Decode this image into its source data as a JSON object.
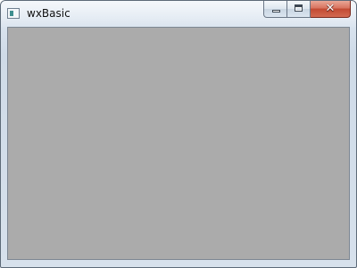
{
  "window": {
    "title": "wxBasic",
    "icon": "app-window-icon"
  },
  "caption_buttons": {
    "minimize_icon": "minimize-icon",
    "maximize_icon": "maximize-icon",
    "close_icon": "close-icon",
    "close_glyph": "✕"
  },
  "colors": {
    "client_background": "#ababab",
    "close_button": "#c9503a"
  }
}
